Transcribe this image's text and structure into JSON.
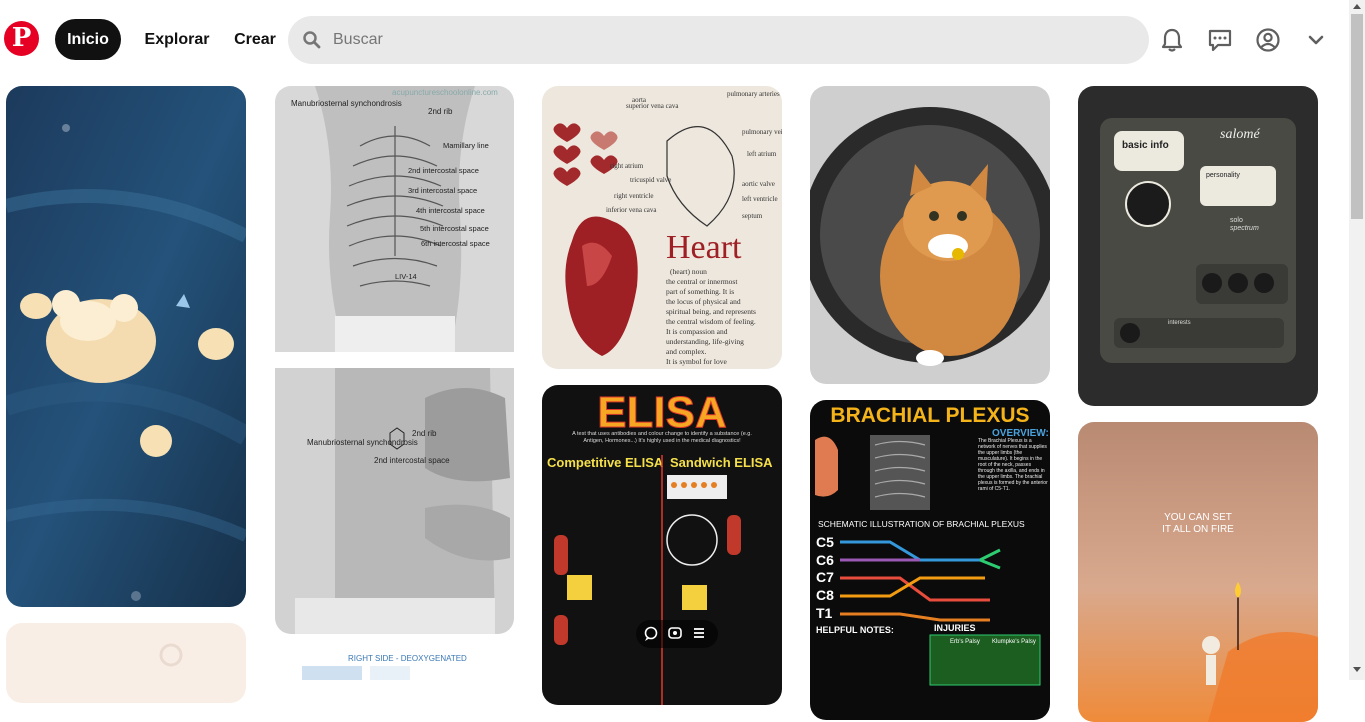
{
  "header": {
    "logo_letter": "P",
    "nav": {
      "home": "Inicio",
      "explore": "Explorar",
      "create": "Crear"
    },
    "search": {
      "placeholder": "Buscar"
    },
    "icons": [
      "bell-icon",
      "chat-icon",
      "profile-icon",
      "chevron-down-icon"
    ]
  },
  "pins": {
    "ribcage": {
      "watermark": "acupunctureschoolonline.com",
      "labels": [
        "Manubriosternal synchondrosis",
        "2nd rib",
        "Mamillary line",
        "2nd intercostal space",
        "3rd intercostal space",
        "4th intercostal space",
        "5th intercostal space",
        "6th intercostal space",
        "LIV-14"
      ]
    },
    "chest": {
      "labels": [
        "Manubriosternal synchondrosis",
        "2nd rib",
        "2nd intercostal space"
      ]
    },
    "heart_small": {
      "caption": "RIGHT SIDE - DEOXYGENATED"
    },
    "heart": {
      "title": "Heart",
      "labels": [
        "aorta",
        "superior vena cava",
        "pulmonary arteries",
        "pulmonary veins",
        "left atrium",
        "right atrium",
        "tricuspid valve",
        "right ventricle",
        "inferior vena cava",
        "left ventricle",
        "aortic valve",
        "septum"
      ],
      "text": [
        "(heart) noun",
        "the central or innermost",
        "part of something. It is",
        "the locus of physical and",
        "spiritual being, and represents",
        "the central wisdom of feeling.",
        "It is compassion and",
        "understanding, life-giving",
        "and complex.",
        "It is symbol for love"
      ]
    },
    "elisa": {
      "title": "ELISA",
      "sub1": "Competitive ELISA",
      "sub2": "Sandwich ELISA",
      "intro": "A test that uses antibodies and colour change to identify a substance (e.g. Antigen, Hormones...) It's highly used in the medical diagnostics!"
    },
    "brachial": {
      "title": "BRACHIAL PLEXUS",
      "overview_title": "OVERVIEW:",
      "overview": "The Brachial Plexus is a network of nerves that supplies the upper limbs (the musculature). It begins in the root of the neck, passes through the axilla, and ends in the upper limbs. The brachial plexus is formed by the anterior rami of C5-T1.",
      "schematic": "SCHEMATIC ILLUSTRATION OF BRACHIAL PLEXUS",
      "roots": [
        "C5",
        "C6",
        "C7",
        "C8",
        "T1"
      ],
      "helpful": "HELPFUL NOTES:",
      "injuries": "INJURIES",
      "injury_cols": [
        "Erb's Palsy",
        "Klumpke's Palsy"
      ]
    },
    "salome": {
      "brand": "salomé",
      "basic_info": "basic info",
      "personality": "personality",
      "spectrum_a": "solo",
      "spectrum_b": "spectrum",
      "interests": "interests"
    },
    "fire": {
      "text_line1": "YOU CAN SET",
      "text_line2": "IT ALL ON FIRE"
    }
  },
  "colors": {
    "brand": "#e60023",
    "search_bg": "#e9e9e9",
    "nav_active_bg": "#111111"
  }
}
